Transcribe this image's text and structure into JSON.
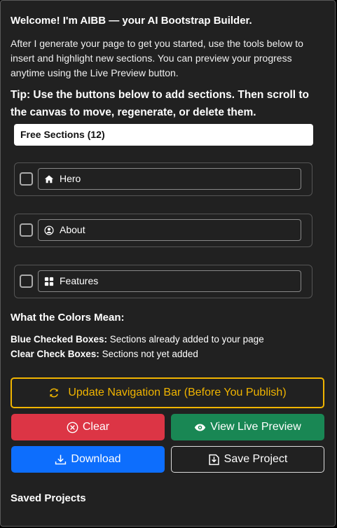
{
  "header": {
    "welcome": "Welcome! I'm AIBB — your AI Bootstrap Builder.",
    "intro": "After I generate your page to get you started, use the tools below to insert and highlight new sections. You can preview your progress anytime using the Live Preview button.",
    "tip": "Tip: Use the buttons below to add sections. Then scroll to the canvas to move, regenerate, or delete them."
  },
  "sections_dropdown": {
    "selected": "Free Sections (12)"
  },
  "sections": [
    {
      "label": "Hero",
      "icon": "house-icon",
      "checked": false
    },
    {
      "label": "About",
      "icon": "person-circle-icon",
      "checked": false
    },
    {
      "label": "Features",
      "icon": "grid-icon",
      "checked": false
    }
  ],
  "legend": {
    "heading": "What the Colors Mean:",
    "blue_label": "Blue Checked Boxes:",
    "blue_text": " Sections already added to your page",
    "clear_label": "Clear Check Boxes:",
    "clear_text": " Sections not yet added"
  },
  "actions": {
    "nav": "Update Navigation Bar (Before You Publish)",
    "clear": "Clear",
    "preview": "View Live Preview",
    "download": "Download",
    "save": "Save Project"
  },
  "saved": {
    "heading": "Saved Projects"
  },
  "colors": {
    "warning": "#f0b400",
    "danger": "#dc3545",
    "success": "#198754",
    "primary": "#0d6efd"
  }
}
